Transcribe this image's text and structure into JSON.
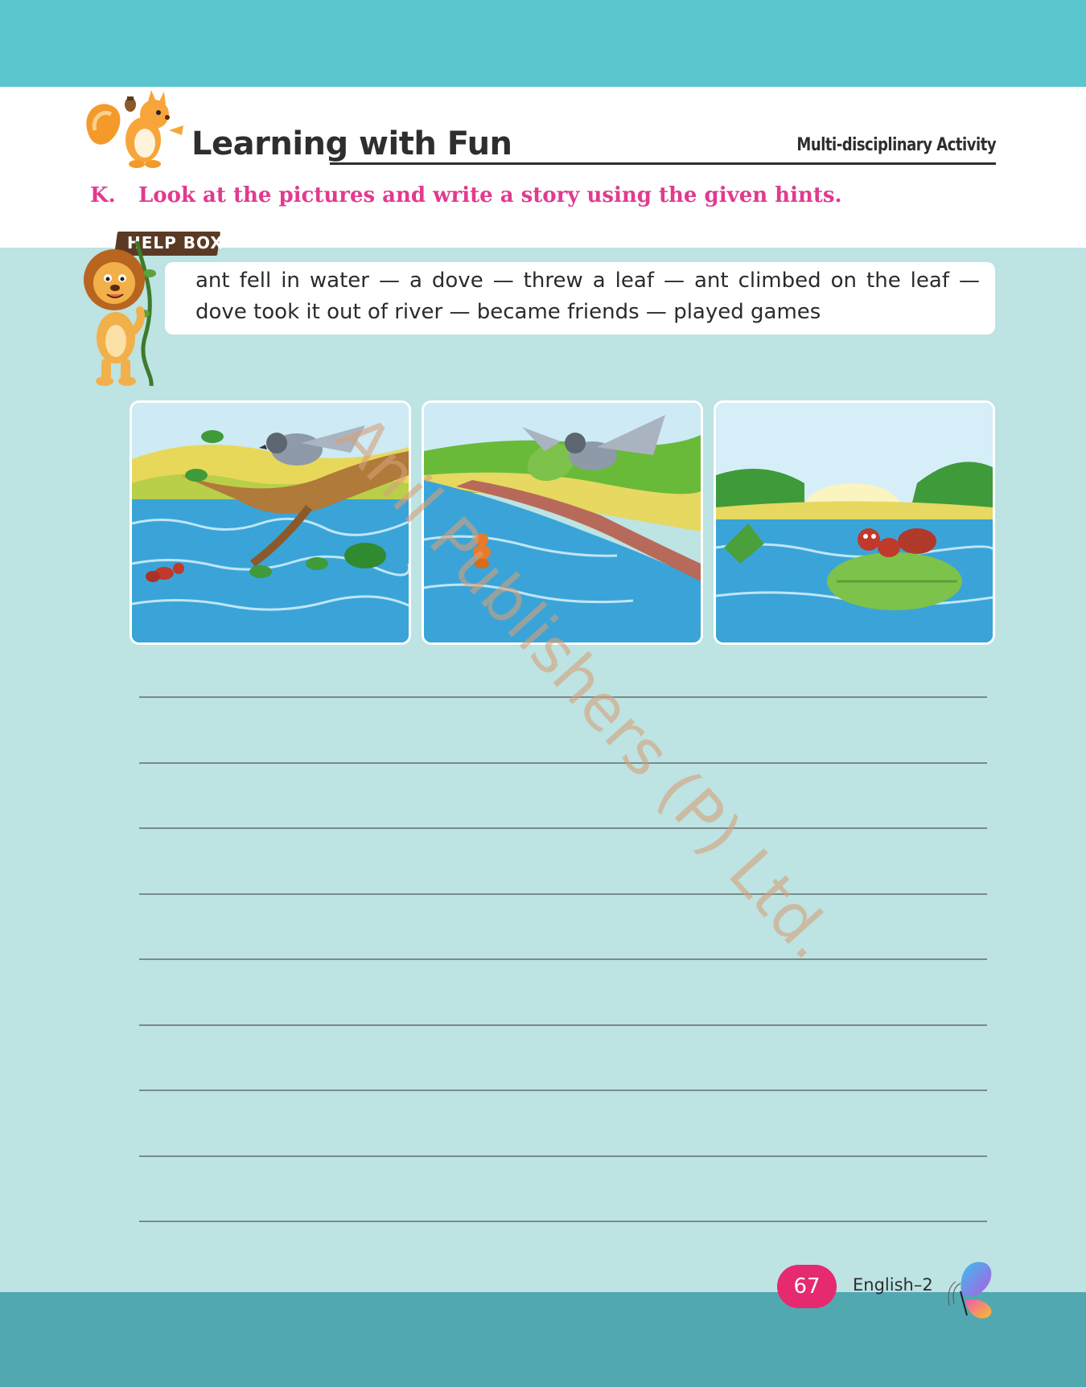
{
  "header": {
    "title": "Learning with Fun",
    "activity_label": "Multi-disciplinary Activity"
  },
  "question": {
    "number": "K.",
    "text": "Look at the pictures and write a story using the given hints."
  },
  "help_box": {
    "label": "HELP BOX",
    "hints": "ant fell in water — a dove — threw a leaf — ant climbed on the leaf — dove took it out of river — became friends — played games"
  },
  "watermark": "Anil Publishers (P) Ltd.",
  "footer": {
    "page_number": "67",
    "book": "English–2"
  },
  "colors": {
    "top_band": "#5bc5cd",
    "page_background": "#bde3e3",
    "bottom_band": "#52a8b0",
    "question_text": "#e23a8f",
    "page_badge": "#e52a6f"
  },
  "illustrations": [
    "squirrel-mascot",
    "lion-mascot",
    "ant-in-water-dove-on-branch",
    "dove-with-leaf",
    "ant-on-leaf",
    "butterfly-logo"
  ]
}
